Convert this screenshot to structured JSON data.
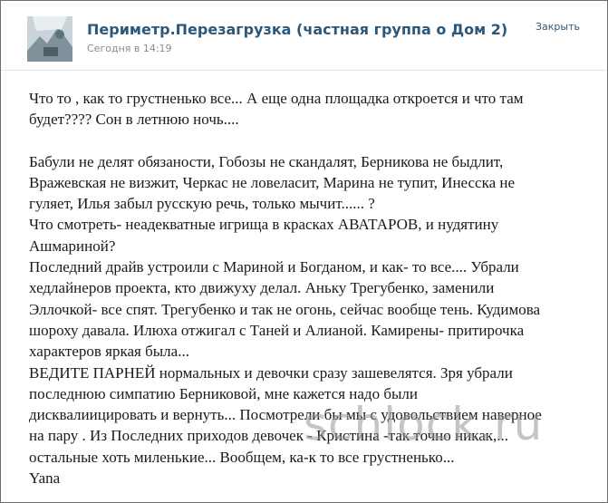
{
  "header": {
    "group_title": "Периметр.Перезагрузка (частная группа о Дом 2)",
    "post_time": "Сегодня в 14:19",
    "close_label": "Закрыть"
  },
  "post": {
    "paragraphs": [
      [
        "Что то , как то грустненько все... А еще одна площадка откроется и что там",
        "будет???? Сон в летнюю ночь...."
      ],
      [
        "Бабули не делят обязаности, Гобозы не скандалят, Берникова не быдлит,",
        "Вражевская не визжит, Черкас не ловеласит, Марина не тупит, Инесска не",
        "гуляет, Илья забыл русскую речь, только мычит...... ?",
        "Что смотреть- неадекватные игрища в красках АВАТАРОВ, и нудятину",
        "Ашмариной?",
        "Последний драйв устроили с Мариной и Богданом, и как- то все.... Убрали",
        "хедлайнеров проекта, кто движуху делал. Аньку Трегубенко, заменили",
        "Эллочкой- все спят. Трегубенко и так не огонь, сейчас вообще тень. Кудимова",
        "шороху давала. Илюха отжигал с Таней и Алианой. Камирены- притирочка",
        "характеров яркая была...",
        "ВЕДИТЕ ПАРНЕЙ нормальных и девочки сразу зашевелятся. Зря убрали",
        "последнюю симпатию Берниковой, мне кажется надо были",
        "дисквалиицировать и вернуть... Посмотрели бы мы с удовольствием наверное",
        "на пару . Из Последних приходов девочек - Кристина -так точно никак,...",
        "остальные хоть миленькие... Вообщем, ка-к то все грустненько..."
      ]
    ],
    "signature": "Yana"
  },
  "watermark": "schlock.ru",
  "colors": {
    "link": "#2b587a",
    "meta": "#8a8a8a",
    "text": "#1a1a1a",
    "frame": "#6f6f6f"
  }
}
